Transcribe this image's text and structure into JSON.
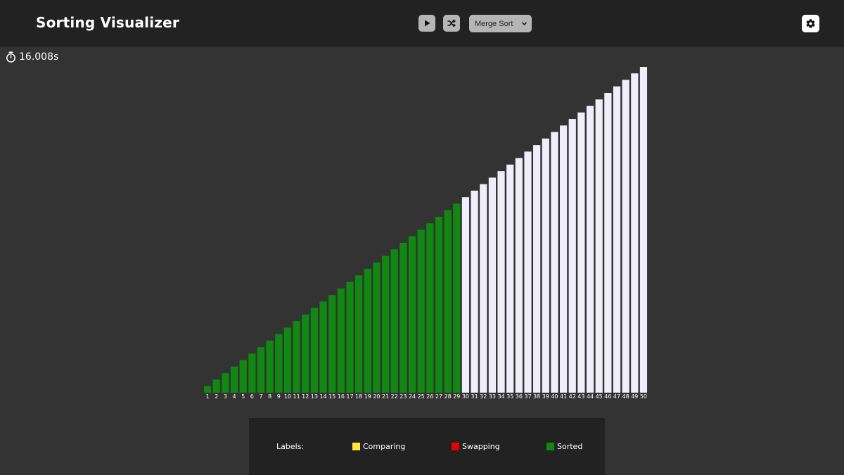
{
  "header": {
    "title": "Sorting Visualizer",
    "algorithm": {
      "selected": "Merge Sort"
    }
  },
  "icons": {
    "play": "play-icon",
    "shuffle": "shuffle-icon",
    "settings": "gear-icon",
    "timer": "stopwatch-icon",
    "select": "chevron-down-icon"
  },
  "timer": {
    "value": "16.008s"
  },
  "colors": {
    "header_bg": "#222222",
    "page_bg": "#333333",
    "sorted": "#118811",
    "unsorted": "#f1eefc",
    "comparing": "#ffe63a",
    "swapping": "#ee0000"
  },
  "legend": {
    "title": "Labels:",
    "items": [
      {
        "label": "Comparing",
        "color": "#ffe63a"
      },
      {
        "label": "Swapping",
        "color": "#ee0000"
      },
      {
        "label": "Sorted",
        "color": "#118811"
      }
    ]
  },
  "chart_data": {
    "type": "bar",
    "categories": [
      "1",
      "2",
      "3",
      "4",
      "5",
      "6",
      "7",
      "8",
      "9",
      "10",
      "11",
      "12",
      "13",
      "14",
      "15",
      "16",
      "17",
      "18",
      "19",
      "20",
      "21",
      "22",
      "23",
      "24",
      "25",
      "26",
      "27",
      "28",
      "29",
      "30",
      "31",
      "32",
      "33",
      "34",
      "35",
      "36",
      "37",
      "38",
      "39",
      "40",
      "41",
      "42",
      "43",
      "44",
      "45",
      "46",
      "47",
      "48",
      "49",
      "50"
    ],
    "values": [
      1,
      2,
      3,
      4,
      5,
      6,
      7,
      8,
      9,
      10,
      11,
      12,
      13,
      14,
      15,
      16,
      17,
      18,
      19,
      20,
      21,
      22,
      23,
      24,
      25,
      26,
      27,
      28,
      29,
      30,
      31,
      32,
      33,
      34,
      35,
      36,
      37,
      38,
      39,
      40,
      41,
      42,
      43,
      44,
      45,
      46,
      47,
      48,
      49,
      50
    ],
    "sorted_count": 29,
    "ylim": [
      0,
      50
    ]
  }
}
